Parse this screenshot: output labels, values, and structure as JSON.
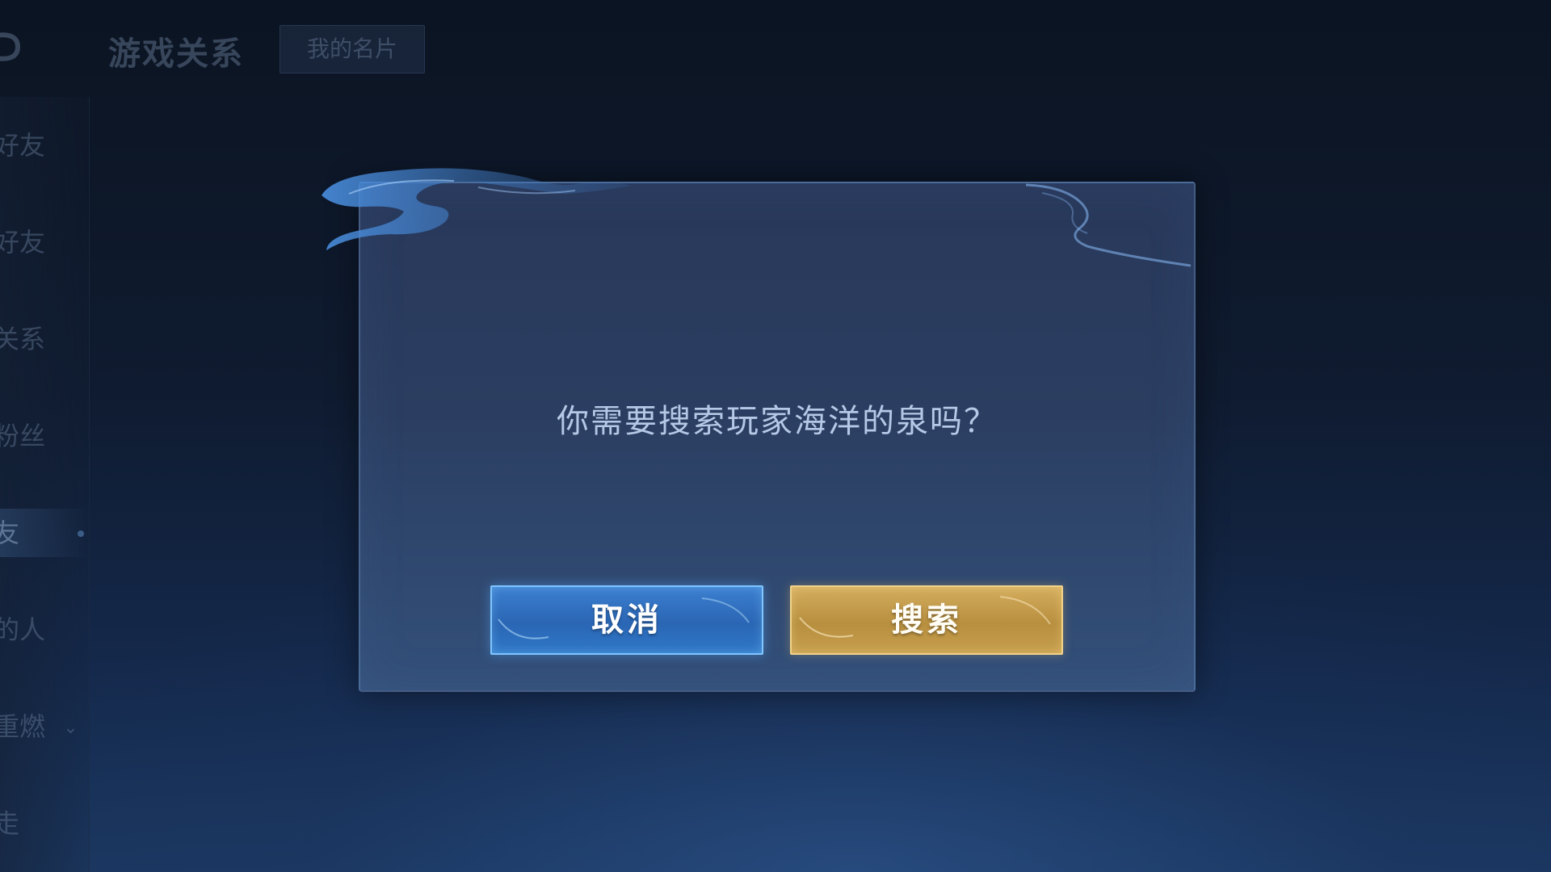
{
  "header": {
    "title": "游戏关系",
    "my_card_tab": "我的名片",
    "back_icon": "back-arrow-icon"
  },
  "sidebar": {
    "items": [
      {
        "label": "好友"
      },
      {
        "label": "好友"
      },
      {
        "label": "关系"
      },
      {
        "label": "粉丝"
      },
      {
        "label": "友"
      },
      {
        "label": "的人"
      },
      {
        "label": "重燃"
      },
      {
        "label": "走"
      }
    ],
    "active_index": 4,
    "expand_icon": "chevron-down-icon"
  },
  "dialog": {
    "message": "你需要搜索玩家海洋的泉吗？",
    "cancel_label": "取消",
    "confirm_label": "搜索"
  },
  "colors": {
    "cancel_button": "#2f6fc0",
    "confirm_button": "#c49a4a",
    "dialog_bg": "#2b3e61",
    "message_text": "#b6c8e6"
  }
}
